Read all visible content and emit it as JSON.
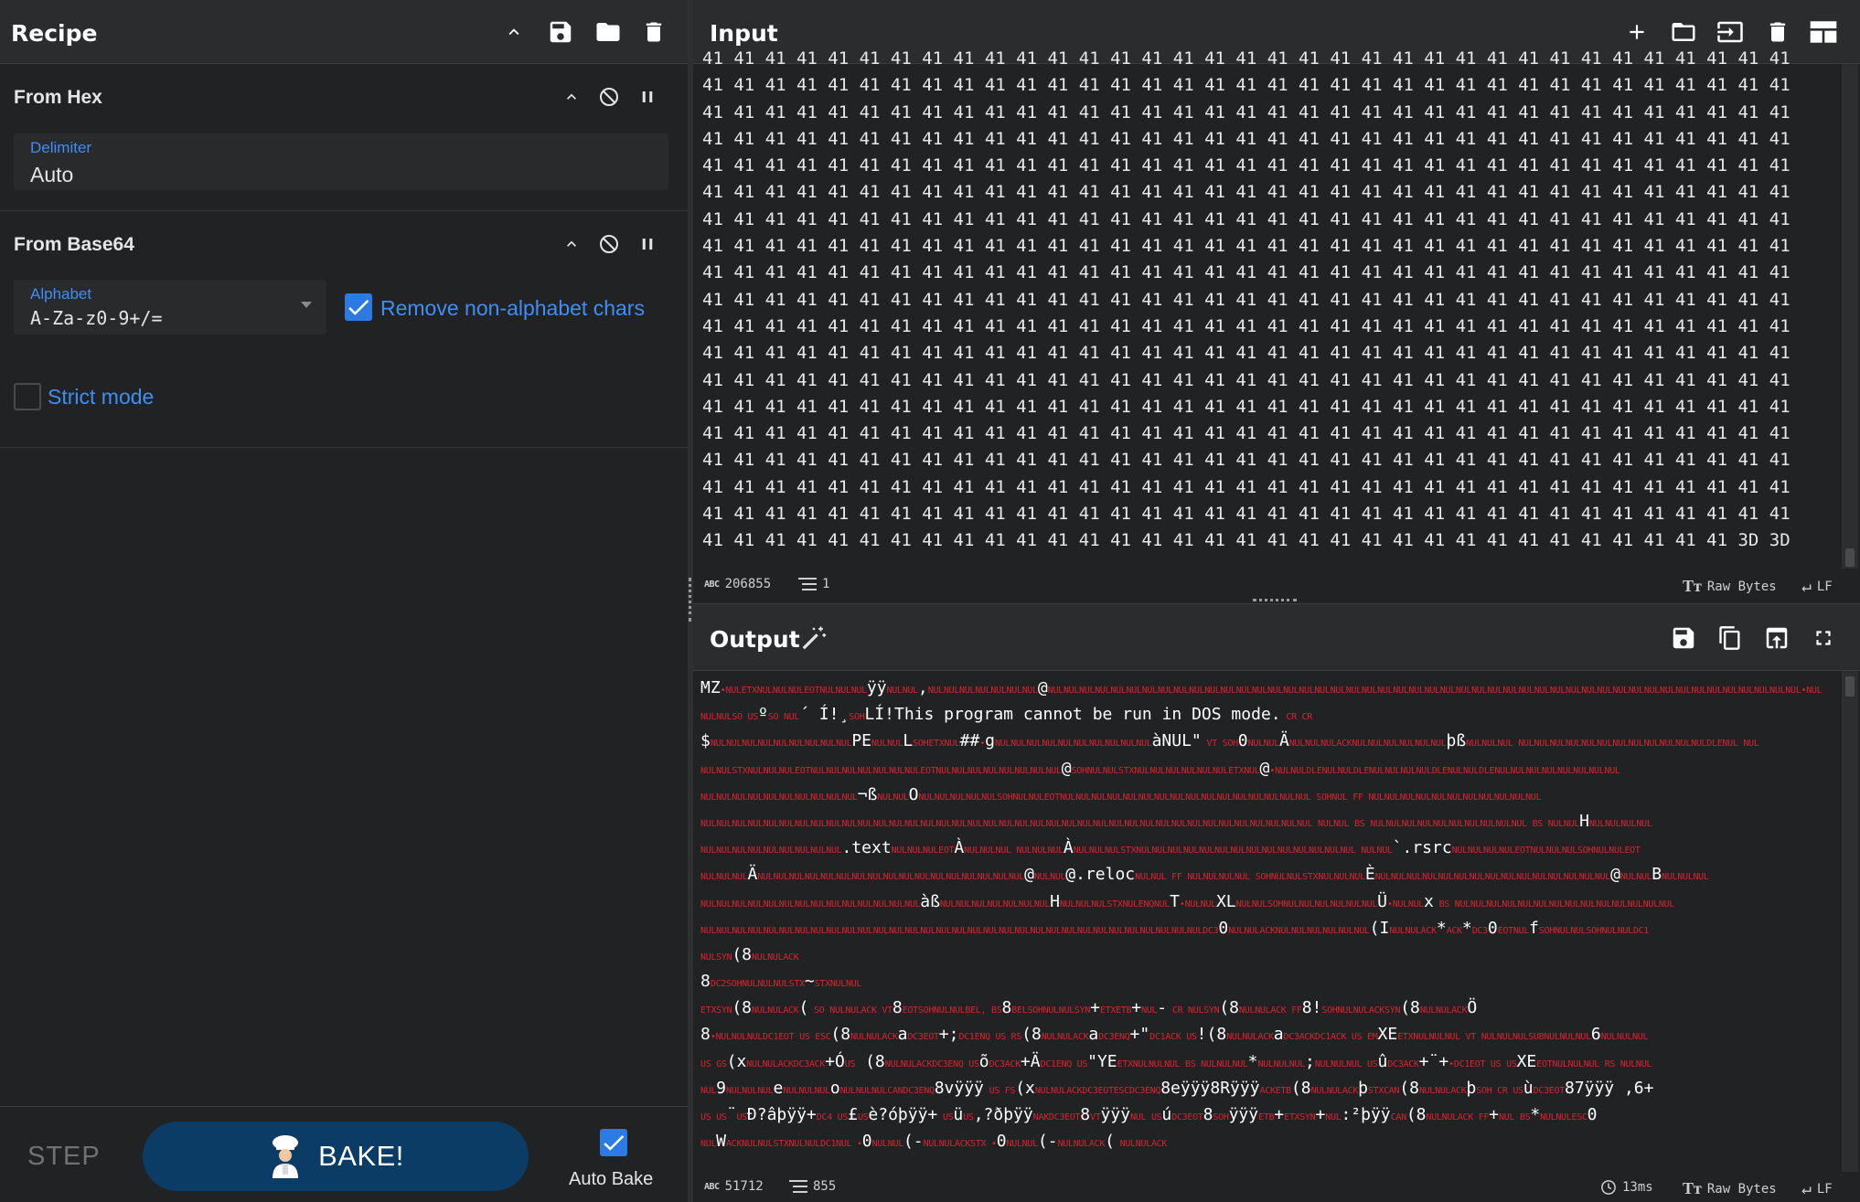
{
  "recipe": {
    "title": "Recipe",
    "operations": [
      {
        "name": "From Hex",
        "field": {
          "label": "Delimiter",
          "value": "Auto"
        }
      },
      {
        "name": "From Base64",
        "field": {
          "label": "Alphabet",
          "value": "A-Za-z0-9+/="
        },
        "checkbox_remove": {
          "label": "Remove non-alphabet chars",
          "checked": true
        },
        "checkbox_strict": {
          "label": "Strict mode",
          "checked": false
        }
      }
    ],
    "controls": {
      "step_label": "STEP",
      "bake_label": "BAKE!",
      "autobake_label": "Auto Bake",
      "autobake_checked": true
    }
  },
  "input": {
    "title": "Input",
    "hex_rows": 19,
    "hex_cols": 35,
    "byte": "41",
    "last_row_tail": "3D 3D",
    "last_row_count": 33,
    "status": {
      "length": "206855",
      "lines": "1",
      "encoding": "Raw Bytes",
      "eol": "LF"
    }
  },
  "output": {
    "title": "Output",
    "lines": [
      [
        [
          "w",
          "MZ"
        ],
        [
          "c",
          "•NULETXNULNULNULEOTNULNULNUL"
        ],
        [
          "w",
          "ÿÿ"
        ],
        [
          "c",
          "NULNUL"
        ],
        [
          "w",
          ","
        ],
        [
          "c",
          "NULNULNULNULNULNULNUL"
        ],
        [
          "w",
          "@"
        ],
        [
          "c",
          "NULNULNULNULNULNULNULNULNULNULNULNULNULNULNULNULNULNULNULNULNULNULNULNULNULNULNULNULNULNULNULNULNULNULNULNULNULNULNULNULNULNULNULNULNULNULNULNUL•NUL"
        ]
      ],
      [
        [
          "c",
          "NULNULSO US"
        ],
        [
          "w",
          "º"
        ],
        [
          "c",
          "SO NUL"
        ],
        [
          "w",
          "´   Í!¸"
        ],
        [
          "c",
          "SOH"
        ],
        [
          "w",
          "LÍ!This program cannot be run in DOS mode."
        ],
        [
          "c",
          " CR CR"
        ]
      ],
      [
        [
          "w",
          "$"
        ],
        [
          "c",
          "NULNULNULNULNULNULNULNULNUL"
        ],
        [
          "w",
          "PE"
        ],
        [
          "c",
          "NULNUL"
        ],
        [
          "w",
          "L"
        ],
        [
          "c",
          "SOHETXNUL"
        ],
        [
          "w",
          "##"
        ],
        [
          "c",
          "•"
        ],
        [
          "w",
          "g"
        ],
        [
          "c",
          "NULNULNULNULNULNULNULNULNULNUL"
        ],
        [
          "w",
          "àNUL\""
        ],
        [
          "c",
          " VT SOH"
        ],
        [
          "w",
          "0"
        ],
        [
          "c",
          "NULNUL"
        ],
        [
          "w",
          "Ä"
        ],
        [
          "c",
          "NULNULNULACKNULNULNULNULNULNUL"
        ],
        [
          "w",
          "þß"
        ],
        [
          "c",
          "NULNULNUL  NULNULNULNULNULNULNULNULNULNULNULNULDLENUL NUL"
        ]
      ],
      [
        [
          "c",
          "NULNULSTXNULNULNULEOTNULNULNULNULNULNULNULEOTNULNULNULNULNULNULNULNUL"
        ],
        [
          "w",
          "@"
        ],
        [
          "c",
          "SOHNULNULSTXNULNULNULNULNULNULETXNUL"
        ],
        [
          "w",
          "@"
        ],
        [
          "c",
          "•NULNULDLENULNULDLENULNULNULNULDLENULNULDLENULNULNULNULNULNULNULNUL"
        ]
      ],
      [
        [
          "c",
          "NULNULNULNULNULNULNULNULNULNUL"
        ],
        [
          "w",
          "¬ß"
        ],
        [
          "c",
          "NULNUL"
        ],
        [
          "w",
          "O"
        ],
        [
          "c",
          "NULNULNULNULNULSOHNULNULEOTNULNULNULNULNULNULNULNULNULNULNULNULNULNULNULNUL  SOHNUL FF NULNULNULNULNULNULNULNULNULNULNUL"
        ]
      ],
      [
        [
          "c",
          "NULNULNULNULNULNULNULNULNULNULNULNULNULNULNULNULNULNULNULNULNULNULNULNULNULNULNULNULNULNULNULNULNULNULNULNULNULNULNUL  NULNUL BS NULNULNULNULNULNULNULNULNULNUL BS   NULNUL"
        ],
        [
          "w",
          "H"
        ],
        [
          "c",
          "NULNULNULNUL"
        ]
      ],
      [
        [
          "c",
          "NULNULNULNULNULNULNULNULNUL"
        ],
        [
          "w",
          ".text"
        ],
        [
          "c",
          "NULNULNULEOT"
        ],
        [
          "w",
          "À"
        ],
        [
          "c",
          "NULNULNUL  NULNULNUL"
        ],
        [
          "w",
          "À"
        ],
        [
          "c",
          "NULNULNULSTXNULNULNULNULNULNULNULNULNULNULNULNULNULNUL  NULNUL"
        ],
        [
          "w",
          "`.rsrc"
        ],
        [
          "c",
          "NULNULNULNULEOTNULNULNULSOHNULNULEOT"
        ]
      ],
      [
        [
          "c",
          "NULNULNUL"
        ],
        [
          "w",
          "Ä"
        ],
        [
          "c",
          "NULNULNULNULNULNULNULNULNULNULNULNULNULNULNULNULNUL"
        ],
        [
          "w",
          "@"
        ],
        [
          "c",
          "NULNUL"
        ],
        [
          "w",
          "@.reloc"
        ],
        [
          "c",
          "NULNUL FF NULNULNULNUL  SOHNULNULSTXNULNULNUL"
        ],
        [
          "w",
          "È"
        ],
        [
          "c",
          "NULNULNULNULNULNULNULNULNULNULNULNULNULNULNUL"
        ],
        [
          "w",
          "@"
        ],
        [
          "c",
          "NULNUL"
        ],
        [
          "w",
          "B"
        ],
        [
          "c",
          "NULNULNUL"
        ]
      ],
      [
        [
          "c",
          "NULNULNULNULNULNULNULNULNULNULNULNULNULNUL"
        ],
        [
          "w",
          "àß"
        ],
        [
          "c",
          "NULNULNULNULNULNULNUL"
        ],
        [
          "w",
          "H"
        ],
        [
          "c",
          "NULNULNULSTXNULENQNUL"
        ],
        [
          "w",
          "T"
        ],
        [
          "c",
          "•NULNUL"
        ],
        [
          "w",
          "XL"
        ],
        [
          "c",
          "NULNULSOHNULNULNULNULNULNUL"
        ],
        [
          "w",
          "Ü"
        ],
        [
          "c",
          "•NULNUL"
        ],
        [
          "w",
          "x"
        ],
        [
          "c",
          " BS NULNULNULNULNULNULNULNULNULNULNULNULNULNUL"
        ]
      ],
      [
        [
          "c",
          "NULNULNULNULNULNULNULNULNULNULNULNULNULNULNULNULNULNULNULNULNULNULNULNULNULNULNULNULNULNULNULNULDC3"
        ],
        [
          "w",
          "0"
        ],
        [
          "c",
          "NULNULACKNULNULNULNULNULNUL"
        ],
        [
          "w",
          "(I"
        ],
        [
          "c",
          "NULNULACK"
        ],
        [
          "w",
          "*"
        ],
        [
          "c",
          "ACK"
        ],
        [
          "w",
          "*"
        ],
        [
          "c",
          "DC3"
        ],
        [
          "w",
          "0"
        ],
        [
          "c",
          "EOTNUL"
        ],
        [
          "w",
          "f"
        ],
        [
          "c",
          "SOHNULNULSOHNULNULDC1"
        ]
      ],
      [
        [
          "c",
          "NULSYN"
        ],
        [
          "w",
          "(8"
        ],
        [
          "c",
          "NULNULACK"
        ]
      ],
      [
        [
          "w",
          "8"
        ],
        [
          "c",
          "DC2SOHNULNULNULSTX"
        ],
        [
          "w",
          "~"
        ],
        [
          "c",
          "STXNULNUL"
        ]
      ],
      [
        [
          "c",
          "ETXSYN"
        ],
        [
          "w",
          "(8"
        ],
        [
          "c",
          "NULNULACK"
        ],
        [
          "w",
          "("
        ],
        [
          "c",
          " SO NULNULACK VT"
        ],
        [
          "w",
          "8"
        ],
        [
          "c",
          "EOTSOHNULNULBEL, BS"
        ],
        [
          "w",
          "8"
        ],
        [
          "c",
          "BELSOHNULNULSYN"
        ],
        [
          "w",
          "+"
        ],
        [
          "c",
          "ETXETB"
        ],
        [
          "w",
          "+"
        ],
        [
          "c",
          "NUL"
        ],
        [
          "w",
          "-"
        ],
        [
          "c",
          " CR NULSYN"
        ],
        [
          "w",
          "(8"
        ],
        [
          "c",
          "NULNULACK FF"
        ],
        [
          "w",
          "8!"
        ],
        [
          "c",
          "SOHNULNULACKSYN"
        ],
        [
          "w",
          "(8"
        ],
        [
          "c",
          "NULNULACK"
        ],
        [
          "w",
          "Ö"
        ]
      ],
      [
        [
          "w",
          "8"
        ],
        [
          "c",
          "•NULNULNULDC1EOT US ESC"
        ],
        [
          "w",
          "(8"
        ],
        [
          "c",
          "NULNULACK"
        ],
        [
          "w",
          "a"
        ],
        [
          "c",
          "DC3EOT"
        ],
        [
          "w",
          "+;"
        ],
        [
          "c",
          "DC1ENQ US RS"
        ],
        [
          "w",
          "(8"
        ],
        [
          "c",
          "NULNULACK"
        ],
        [
          "w",
          "a"
        ],
        [
          "c",
          "DC3ENQ"
        ],
        [
          "w",
          "+\""
        ],
        [
          "c",
          "DC1ACK US"
        ],
        [
          "w",
          "!(8"
        ],
        [
          "c",
          "NULNULACK"
        ],
        [
          "w",
          "a"
        ],
        [
          "c",
          "DC3ACKDC1ACK US EM"
        ],
        [
          "w",
          "XE"
        ],
        [
          "c",
          "ETXNULNULNUL VT NULNULNULSUBNULNULNUL"
        ],
        [
          "w",
          "6"
        ],
        [
          "c",
          "NULNULNUL"
        ]
      ],
      [
        [
          "c",
          " US GS"
        ],
        [
          "w",
          "(x"
        ],
        [
          "c",
          "NULNULACKDC3ACK"
        ],
        [
          "w",
          "+Ó"
        ],
        [
          "c",
          "US"
        ],
        [
          "w",
          "  (8"
        ],
        [
          "c",
          "NULNULACKDC3ENQ US"
        ],
        [
          "w",
          "õ"
        ],
        [
          "c",
          "DC3ACK"
        ],
        [
          "w",
          "+Ä"
        ],
        [
          "c",
          "DC1ENQ US"
        ],
        [
          "w",
          "\"YE"
        ],
        [
          "c",
          "ETXNULNULNUL BS NULNULNUL"
        ],
        [
          "w",
          "*"
        ],
        [
          "c",
          "NULNULNUL"
        ],
        [
          "w",
          ";"
        ],
        [
          "c",
          "NULNULNUL US"
        ],
        [
          "w",
          "û"
        ],
        [
          "c",
          "DC3ACK"
        ],
        [
          "w",
          "+¨+"
        ],
        [
          "c",
          "•DC1EOT US US"
        ],
        [
          "w",
          "XE"
        ],
        [
          "c",
          "EOTNULNULNUL RS NULNUL"
        ]
      ],
      [
        [
          "c",
          "NUL"
        ],
        [
          "w",
          "9"
        ],
        [
          "c",
          "NULNULNUL"
        ],
        [
          "w",
          "e"
        ],
        [
          "c",
          "NULNULNUL"
        ],
        [
          "w",
          "o"
        ],
        [
          "c",
          "NULNULNULCANDC3ENQ"
        ],
        [
          "w",
          "8vÿÿÿ"
        ],
        [
          "c",
          " US FS"
        ],
        [
          "w",
          "(x"
        ],
        [
          "c",
          "NULNULACKDC3EOTESCDC3ENQ"
        ],
        [
          "w",
          "8eÿÿÿ8Rÿÿÿ"
        ],
        [
          "c",
          "ACKETB"
        ],
        [
          "w",
          "(8"
        ],
        [
          "c",
          "NULNULACK"
        ],
        [
          "w",
          "þ"
        ],
        [
          "c",
          "STXCAN"
        ],
        [
          "w",
          "(8"
        ],
        [
          "c",
          "NULNULACK"
        ],
        [
          "w",
          "þ"
        ],
        [
          "c",
          "SOH CR US"
        ],
        [
          "w",
          "ù"
        ],
        [
          "c",
          "DC3EOT"
        ],
        [
          "w",
          "87ÿÿÿ   ,6+"
        ]
      ],
      [
        [
          "c",
          " US US"
        ],
        [
          "w",
          "¨"
        ],
        [
          "c",
          "US"
        ],
        [
          "w",
          "Ð?âþÿÿ+"
        ],
        [
          "c",
          "DC4 US"
        ],
        [
          "w",
          "£"
        ],
        [
          "c",
          "US"
        ],
        [
          "w",
          "è?óþÿÿ+"
        ],
        [
          "c",
          "  US"
        ],
        [
          "w",
          "ü"
        ],
        [
          "c",
          "US"
        ],
        [
          "w",
          ",?ðþÿÿ"
        ],
        [
          "c",
          "NAKDC3EOT"
        ],
        [
          "w",
          "8"
        ],
        [
          "c",
          "VT"
        ],
        [
          "w",
          "ÿÿÿ"
        ],
        [
          "c",
          "NUL US"
        ],
        [
          "w",
          "ú"
        ],
        [
          "c",
          "DC3EOT"
        ],
        [
          "w",
          "8"
        ],
        [
          "c",
          "SOH"
        ],
        [
          "w",
          "ÿÿÿ"
        ],
        [
          "c",
          "ETB"
        ],
        [
          "w",
          "+"
        ],
        [
          "c",
          "ETXSYN"
        ],
        [
          "w",
          "+"
        ],
        [
          "c",
          "NUL"
        ],
        [
          "w",
          ":²þÿÿ"
        ],
        [
          "c",
          "CAN"
        ],
        [
          "w",
          "(8"
        ],
        [
          "c",
          "NULNULACK FF"
        ],
        [
          "w",
          "+"
        ],
        [
          "c",
          "NUL BS"
        ],
        [
          "w",
          "*"
        ],
        [
          "c",
          "NULNULESC"
        ],
        [
          "w",
          "0"
        ]
      ],
      [
        [
          "c",
          "NUL"
        ],
        [
          "w",
          "W"
        ],
        [
          "c",
          "ACKNULNULSTXNULNULDC1NUL  •"
        ],
        [
          "w",
          "0"
        ],
        [
          "c",
          "NULNUL"
        ],
        [
          "w",
          "(-"
        ],
        [
          "c",
          "NULNULACKSTX  •"
        ],
        [
          "w",
          "0"
        ],
        [
          "c",
          "NULNUL"
        ],
        [
          "w",
          "(-"
        ],
        [
          "c",
          "NULNULACK"
        ],
        [
          "w",
          "("
        ],
        [
          "c",
          "  NULNULACK"
        ]
      ]
    ],
    "status": {
      "length": "51712",
      "lines": "855",
      "time": "13ms",
      "encoding": "Raw Bytes",
      "eol": "LF"
    }
  }
}
